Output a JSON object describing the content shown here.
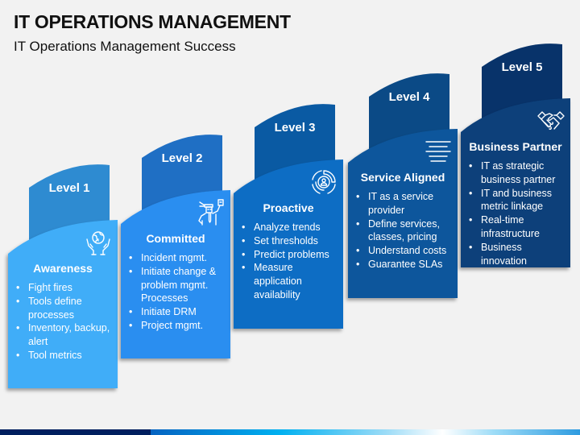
{
  "header": {
    "title": "IT OPERATIONS MANAGEMENT",
    "subtitle": "IT Operations Management Success"
  },
  "levels": [
    {
      "label": "Level 1",
      "title": "Awareness",
      "icon": "globe-in-hands-icon",
      "tab_color": "#2e8bd1",
      "card_color": "#3fadf8",
      "bullets": [
        "Fight fires",
        "Tools define processes",
        "Inventory, backup, alert",
        "Tool metrics"
      ]
    },
    {
      "label": "Level 2",
      "title": "Committed",
      "icon": "committed-worker-icon",
      "tab_color": "#1f6fc4",
      "card_color": "#2a8ef0",
      "bullets": [
        "Incident mgmt.",
        "Initiate change & problem mgmt. Processes",
        "Initiate DRM",
        "Project mgmt."
      ]
    },
    {
      "label": "Level 3",
      "title": "Proactive",
      "icon": "user-target-icon",
      "tab_color": "#0a5aa3",
      "card_color": "#0f6dc4",
      "bullets": [
        "Analyze trends",
        "Set thresholds",
        "Predict problems",
        "Measure application availability"
      ]
    },
    {
      "label": "Level 4",
      "title": "Service Aligned",
      "icon": "align-center-lines-icon",
      "tab_color": "#0b4a86",
      "card_color": "#0d579c",
      "bullets": [
        "IT as a service provider",
        "Define services, classes, pricing",
        "Understand costs",
        "Guarantee SLAs"
      ]
    },
    {
      "label": "Level 5",
      "title": "Business Partner",
      "icon": "handshake-icon",
      "tab_color": "#08336a",
      "card_color": "#0b3f7a",
      "bullets": [
        "IT as strategic business partner",
        "IT and business metric linkage",
        "Real-time infrastructure",
        "Business innovation"
      ]
    }
  ]
}
